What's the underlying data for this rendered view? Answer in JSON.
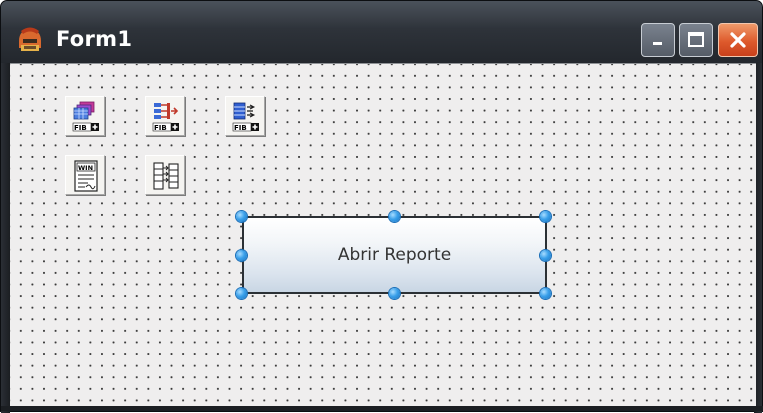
{
  "window": {
    "title": "Form1",
    "app_icon": "spartan-helmet-icon",
    "controls": {
      "minimize_icon": "minimize-icon",
      "maximize_icon": "maximize-icon",
      "close_icon": "close-icon"
    }
  },
  "form": {
    "background": "dotted-design-grid",
    "components": [
      {
        "name": "fib-dataset-component",
        "icon": "fib-dataset-icon",
        "badge": "FIB"
      },
      {
        "name": "fib-query-component",
        "icon": "fib-query-icon",
        "badge": "FIB"
      },
      {
        "name": "fib-transaction-component",
        "icon": "fib-transaction-icon",
        "badge": "FIB"
      },
      {
        "name": "win-report-component",
        "icon": "win-report-icon",
        "badge": "WIN"
      },
      {
        "name": "report-datalink-component",
        "icon": "report-datalink-icon"
      }
    ],
    "button": {
      "label": "Abrir Reporte",
      "selected": true
    }
  },
  "colors": {
    "titlebar": "#2e333a",
    "client": "#efeeee",
    "close_button": "#de5a2c",
    "handle": "#3aa0ea"
  }
}
